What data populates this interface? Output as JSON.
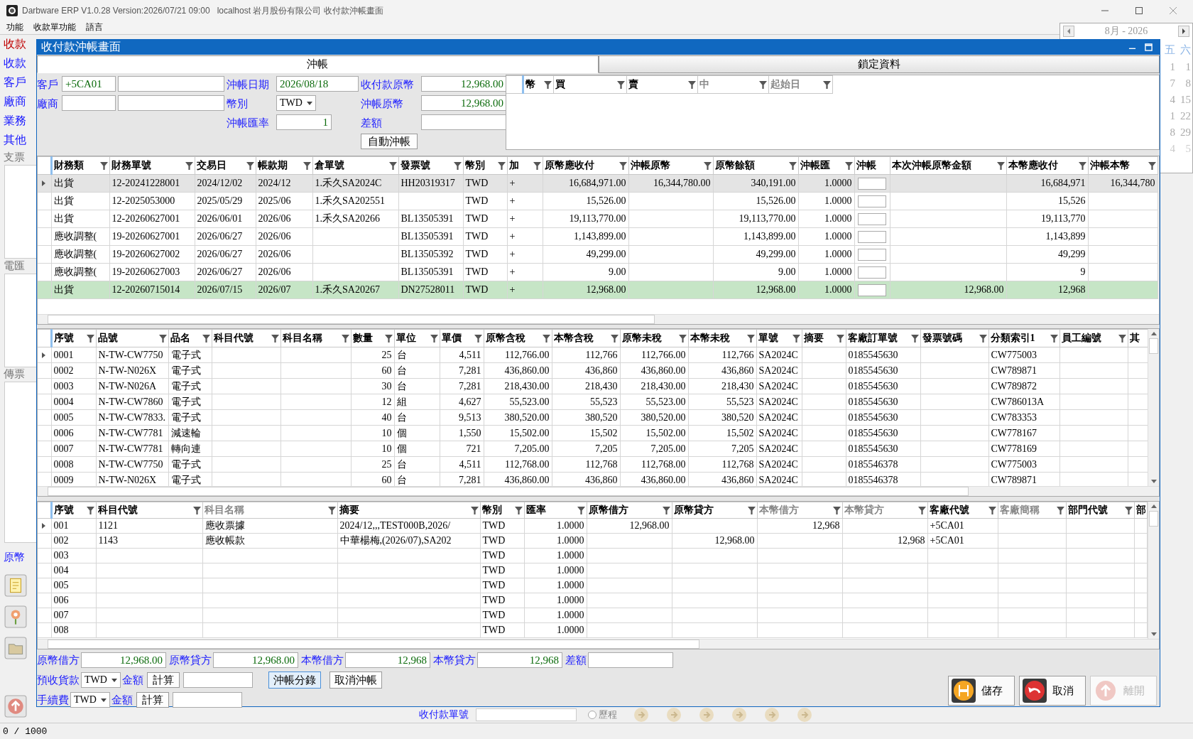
{
  "app": {
    "title": "Darbware ERP V1.0.28 Version:2026/07/21 09:00   localhost 岩月股份有限公司 收付款沖帳畫面",
    "menu": [
      "功能",
      "收款單功能",
      "語言"
    ]
  },
  "background": {
    "left_labels": [
      {
        "text": "收款",
        "kind": "alert"
      },
      {
        "text": "收款",
        "kind": "field"
      },
      {
        "text": "客戶",
        "kind": "field"
      },
      {
        "text": "廠商",
        "kind": "field"
      },
      {
        "text": "業務",
        "kind": "field"
      },
      {
        "text": "其他",
        "kind": "field"
      },
      {
        "text": "支票",
        "kind": "section"
      },
      {
        "text": "電匯",
        "kind": "section"
      },
      {
        "text": "傳票",
        "kind": "section"
      },
      {
        "text": "原幣",
        "kind": "field"
      }
    ],
    "calendar": {
      "month": "8月 - 2026",
      "weekdays": [
        "五",
        "六"
      ],
      "days": [
        [
          "1",
          "1"
        ],
        [
          "7",
          "8"
        ],
        [
          "4",
          "15"
        ],
        [
          "1",
          "22"
        ],
        [
          "8",
          "29"
        ],
        [
          "4",
          "5"
        ]
      ]
    },
    "lookup": {
      "label": "收付款單號",
      "radio": "歷程",
      "checked": false
    }
  },
  "dialog": {
    "title": "收付款沖帳畫面",
    "tabs": [
      {
        "label": "沖帳",
        "selected": true
      },
      {
        "label": "鎖定資料",
        "selected": false
      }
    ],
    "form": {
      "customer": {
        "label": "客戶",
        "code": "+5CA01"
      },
      "vendor": {
        "label": "廠商"
      },
      "date": {
        "label": "沖帳日期",
        "value": "2026/08/18"
      },
      "currency": {
        "label": "幣別",
        "value": "TWD"
      },
      "rate": {
        "label": "沖帳匯率",
        "value": "1"
      },
      "received": {
        "label": "收付款原幣",
        "value": "12,968.00"
      },
      "settled": {
        "label": "沖帳原幣",
        "value": "12,968.00"
      },
      "difference": {
        "label": "差額"
      },
      "auto_button": "自動沖帳"
    },
    "rate_grid": {
      "columns": [
        {
          "label": "幣",
          "muted": false
        },
        {
          "label": "買",
          "muted": false
        },
        {
          "label": "賣",
          "muted": false
        },
        {
          "label": "中",
          "muted": true
        },
        {
          "label": "起始日",
          "muted": true
        }
      ]
    },
    "settle_grid": {
      "columns": [
        {
          "label": "財務類",
          "kind": "text"
        },
        {
          "label": "財務單號",
          "kind": "text"
        },
        {
          "label": "交易日",
          "kind": "text"
        },
        {
          "label": "帳款期",
          "kind": "text"
        },
        {
          "label": "倉單號",
          "kind": "text"
        },
        {
          "label": "發票號",
          "kind": "text"
        },
        {
          "label": "幣別",
          "kind": "text"
        },
        {
          "label": "加",
          "kind": "text"
        },
        {
          "label": "原幣應收付",
          "kind": "number"
        },
        {
          "label": "沖帳原幣",
          "kind": "number"
        },
        {
          "label": "原幣餘額",
          "kind": "number"
        },
        {
          "label": "沖帳匯",
          "kind": "number"
        },
        {
          "label": "沖帳",
          "kind": "check"
        },
        {
          "label": "本次沖帳原幣金額",
          "kind": "number"
        },
        {
          "label": "本幣應收付",
          "kind": "number"
        },
        {
          "label": "沖帳本幣",
          "kind": "number"
        }
      ],
      "rows": [
        {
          "current": true,
          "selected": true,
          "matched": false,
          "checked": false,
          "cells": [
            "出貨",
            "12-20241228001",
            "2024/12/02",
            "2024/12",
            "1.禾久SA2024C",
            "HH20319317",
            "TWD",
            "+",
            "16,684,971.00",
            "16,344,780.00",
            "340,191.00",
            "1.0000",
            "",
            "",
            "16,684,971",
            "16,344,780"
          ]
        },
        {
          "current": false,
          "selected": false,
          "matched": false,
          "checked": false,
          "cells": [
            "出貨",
            "12-2025053000",
            "2025/05/29",
            "2025/06",
            "1.禾久SA202551",
            "",
            "TWD",
            "+",
            "15,526.00",
            "",
            "15,526.00",
            "1.0000",
            "",
            "",
            "15,526",
            ""
          ]
        },
        {
          "current": false,
          "selected": false,
          "matched": false,
          "checked": false,
          "cells": [
            "出貨",
            "12-20260627001",
            "2026/06/01",
            "2026/06",
            "1.禾久SA20266",
            "BL13505391",
            "TWD",
            "+",
            "19,113,770.00",
            "",
            "19,113,770.00",
            "1.0000",
            "",
            "",
            "19,113,770",
            ""
          ]
        },
        {
          "current": false,
          "selected": false,
          "matched": false,
          "checked": false,
          "cells": [
            "應收調整(",
            "19-20260627001",
            "2026/06/27",
            "2026/06",
            "",
            "BL13505391",
            "TWD",
            "+",
            "1,143,899.00",
            "",
            "1,143,899.00",
            "1.0000",
            "",
            "",
            "1,143,899",
            ""
          ]
        },
        {
          "current": false,
          "selected": false,
          "matched": false,
          "checked": false,
          "cells": [
            "應收調整(",
            "19-20260627002",
            "2026/06/27",
            "2026/06",
            "",
            "BL13505392",
            "TWD",
            "+",
            "49,299.00",
            "",
            "49,299.00",
            "1.0000",
            "",
            "",
            "49,299",
            ""
          ]
        },
        {
          "current": false,
          "selected": false,
          "matched": false,
          "checked": false,
          "cells": [
            "應收調整(",
            "19-20260627003",
            "2026/06/27",
            "2026/06",
            "",
            "BL13505391",
            "TWD",
            "+",
            "9.00",
            "",
            "9.00",
            "1.0000",
            "",
            "",
            "9",
            ""
          ]
        },
        {
          "current": false,
          "selected": false,
          "matched": true,
          "checked": false,
          "cells": [
            "出貨",
            "12-20260715014",
            "2026/07/15",
            "2026/07",
            "1.禾久SA20267",
            "DN27528011",
            "TWD",
            "+",
            "12,968.00",
            "",
            "12,968.00",
            "1.0000",
            "",
            "12,968.00",
            "12,968",
            ""
          ]
        }
      ]
    },
    "item_grid": {
      "columns": [
        {
          "label": "序號",
          "kind": "text"
        },
        {
          "label": "品號",
          "kind": "text"
        },
        {
          "label": "品名",
          "kind": "text"
        },
        {
          "label": "科目代號",
          "kind": "text"
        },
        {
          "label": "科目名稱",
          "kind": "text"
        },
        {
          "label": "數量",
          "kind": "number"
        },
        {
          "label": "單位",
          "kind": "text"
        },
        {
          "label": "單價",
          "kind": "number"
        },
        {
          "label": "原幣含稅",
          "kind": "number"
        },
        {
          "label": "本幣含稅",
          "kind": "number"
        },
        {
          "label": "原幣未稅",
          "kind": "number"
        },
        {
          "label": "本幣未稅",
          "kind": "number"
        },
        {
          "label": "單號",
          "kind": "text"
        },
        {
          "label": "摘要",
          "kind": "text"
        },
        {
          "label": "客廠訂單號",
          "kind": "text"
        },
        {
          "label": "發票號碼",
          "kind": "text"
        },
        {
          "label": "分類索引1",
          "kind": "text"
        },
        {
          "label": "員工編號",
          "kind": "text"
        },
        {
          "label": "其",
          "kind": "text"
        }
      ],
      "rows": [
        {
          "current": true,
          "cells": [
            "0001",
            "N-TW-CW7750",
            "電子式",
            "",
            "",
            "25",
            "台",
            "4,511",
            "112,766.00",
            "112,766",
            "112,766.00",
            "112,766",
            "SA2024C",
            "",
            "0185545630",
            "",
            "CW775003",
            "",
            ""
          ]
        },
        {
          "current": false,
          "cells": [
            "0002",
            "N-TW-N026X",
            "電子式",
            "",
            "",
            "60",
            "台",
            "7,281",
            "436,860.00",
            "436,860",
            "436,860.00",
            "436,860",
            "SA2024C",
            "",
            "0185545630",
            "",
            "CW789871",
            "",
            ""
          ]
        },
        {
          "current": false,
          "cells": [
            "0003",
            "N-TW-N026A",
            "電子式",
            "",
            "",
            "30",
            "台",
            "7,281",
            "218,430.00",
            "218,430",
            "218,430.00",
            "218,430",
            "SA2024C",
            "",
            "0185545630",
            "",
            "CW789872",
            "",
            ""
          ]
        },
        {
          "current": false,
          "cells": [
            "0004",
            "N-TW-CW7860",
            "電子式",
            "",
            "",
            "12",
            "組",
            "4,627",
            "55,523.00",
            "55,523",
            "55,523.00",
            "55,523",
            "SA2024C",
            "",
            "0185545630",
            "",
            "CW786013A",
            "",
            ""
          ]
        },
        {
          "current": false,
          "cells": [
            "0005",
            "N-TW-CW7833.",
            "電子式",
            "",
            "",
            "40",
            "台",
            "9,513",
            "380,520.00",
            "380,520",
            "380,520.00",
            "380,520",
            "SA2024C",
            "",
            "0185545630",
            "",
            "CW783353",
            "",
            ""
          ]
        },
        {
          "current": false,
          "cells": [
            "0006",
            "N-TW-CW7781",
            "減速輪",
            "",
            "",
            "10",
            "個",
            "1,550",
            "15,502.00",
            "15,502",
            "15,502.00",
            "15,502",
            "SA2024C",
            "",
            "0185545630",
            "",
            "CW778167",
            "",
            ""
          ]
        },
        {
          "current": false,
          "cells": [
            "0007",
            "N-TW-CW7781",
            "轉向連",
            "",
            "",
            "10",
            "個",
            "721",
            "7,205.00",
            "7,205",
            "7,205.00",
            "7,205",
            "SA2024C",
            "",
            "0185545630",
            "",
            "CW778169",
            "",
            ""
          ]
        },
        {
          "current": false,
          "cells": [
            "0008",
            "N-TW-CW7750",
            "電子式",
            "",
            "",
            "25",
            "台",
            "4,511",
            "112,768.00",
            "112,768",
            "112,768.00",
            "112,768",
            "SA2024C",
            "",
            "0185546378",
            "",
            "CW775003",
            "",
            ""
          ]
        },
        {
          "current": false,
          "cells": [
            "0009",
            "N-TW-N026X",
            "電子式",
            "",
            "",
            "60",
            "台",
            "7,281",
            "436,860.00",
            "436,860",
            "436,860.00",
            "436,860",
            "SA2024C",
            "",
            "0185546378",
            "",
            "CW789871",
            "",
            ""
          ]
        }
      ]
    },
    "voucher_grid": {
      "columns": [
        {
          "label": "序號",
          "kind": "text",
          "muted": false
        },
        {
          "label": "科目代號",
          "kind": "text",
          "muted": false
        },
        {
          "label": "科目名稱",
          "kind": "text",
          "muted": true
        },
        {
          "label": "摘要",
          "kind": "text",
          "muted": false
        },
        {
          "label": "幣別",
          "kind": "text",
          "muted": false
        },
        {
          "label": "匯率",
          "kind": "number",
          "muted": false
        },
        {
          "label": "原幣借方",
          "kind": "number",
          "muted": false
        },
        {
          "label": "原幣貸方",
          "kind": "number",
          "muted": false
        },
        {
          "label": "本幣借方",
          "kind": "number",
          "muted": true
        },
        {
          "label": "本幣貸方",
          "kind": "number",
          "muted": true
        },
        {
          "label": "客廠代號",
          "kind": "text",
          "muted": false
        },
        {
          "label": "客廠簡稱",
          "kind": "text",
          "muted": true
        },
        {
          "label": "部門代號",
          "kind": "text",
          "muted": false
        },
        {
          "label": "部",
          "kind": "text",
          "muted": false
        }
      ],
      "rows": [
        {
          "current": true,
          "cells": [
            "001",
            "1121",
            "應收票據",
            "2024/12,,,TEST000B,2026/",
            "TWD",
            "1.0000",
            "12,968.00",
            "",
            "12,968",
            "",
            "+5CA01",
            "",
            "",
            ""
          ]
        },
        {
          "current": false,
          "cells": [
            "002",
            "1143",
            "應收帳款",
            "中華楊梅,(2026/07),SA202",
            "TWD",
            "1.0000",
            "",
            "12,968.00",
            "",
            "12,968",
            "+5CA01",
            "",
            "",
            ""
          ]
        },
        {
          "current": false,
          "cells": [
            "003",
            "",
            "",
            "",
            "TWD",
            "1.0000",
            "",
            "",
            "",
            "",
            "",
            "",
            "",
            ""
          ]
        },
        {
          "current": false,
          "cells": [
            "004",
            "",
            "",
            "",
            "TWD",
            "1.0000",
            "",
            "",
            "",
            "",
            "",
            "",
            "",
            ""
          ]
        },
        {
          "current": false,
          "cells": [
            "005",
            "",
            "",
            "",
            "TWD",
            "1.0000",
            "",
            "",
            "",
            "",
            "",
            "",
            "",
            ""
          ]
        },
        {
          "current": false,
          "cells": [
            "006",
            "",
            "",
            "",
            "TWD",
            "1.0000",
            "",
            "",
            "",
            "",
            "",
            "",
            "",
            ""
          ]
        },
        {
          "current": false,
          "cells": [
            "007",
            "",
            "",
            "",
            "TWD",
            "1.0000",
            "",
            "",
            "",
            "",
            "",
            "",
            "",
            ""
          ]
        },
        {
          "current": false,
          "cells": [
            "008",
            "",
            "",
            "",
            "TWD",
            "1.0000",
            "",
            "",
            "",
            "",
            "",
            "",
            "",
            ""
          ]
        }
      ]
    },
    "totals": [
      {
        "label": "原幣借方",
        "value": "12,968.00"
      },
      {
        "label": "原幣貸方",
        "value": "12,968.00"
      },
      {
        "label": "本幣借方",
        "value": "12,968"
      },
      {
        "label": "本幣貸方",
        "value": "12,968"
      },
      {
        "label": "差額"
      }
    ],
    "fees": [
      {
        "label": "預收貨款",
        "currency": "TWD",
        "amount_label": "金額",
        "calc_button": "計算"
      },
      {
        "label": "手續費",
        "currency": "TWD",
        "amount_label": "金額",
        "calc_button": "計算"
      }
    ],
    "actions": [
      {
        "label": "沖帳分錄",
        "focused": true
      },
      {
        "label": "取消沖帳",
        "focused": false
      }
    ],
    "buttons": [
      {
        "label": "儲存",
        "kind": "save",
        "disabled": false
      },
      {
        "label": "取消",
        "kind": "cancel",
        "disabled": false
      },
      {
        "label": "離開",
        "kind": "exit",
        "disabled": true
      }
    ]
  },
  "status_bar": "0 / 1000"
}
